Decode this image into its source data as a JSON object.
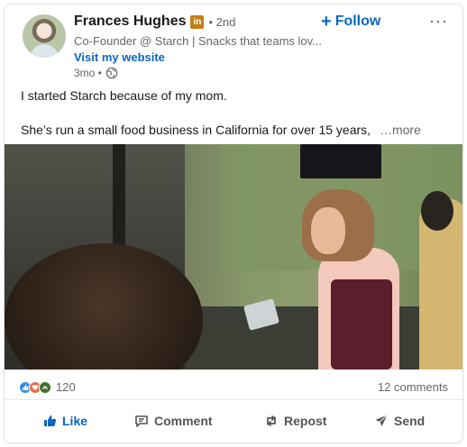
{
  "author": {
    "name": "Frances Hughes",
    "badge": "in",
    "degree": "• 2nd",
    "headline": "Co-Founder @ Starch | Snacks that teams lov...",
    "website": "Visit my website",
    "time": "3mo •",
    "visibility_icon": "globe-icon"
  },
  "follow": {
    "plus": "+",
    "label": "Follow"
  },
  "menu": {
    "label": "···"
  },
  "post": {
    "line1": "I started Starch because of my mom.",
    "line2": "She’s run a small food business in California for over 15 years,",
    "see_more": "…more"
  },
  "media": {
    "kind": "image",
    "description_icon": "cafe-photo"
  },
  "stats": {
    "reactions_count": "120",
    "comments": "12 comments",
    "reaction_types": [
      "like-icon",
      "love-icon",
      "support-icon"
    ]
  },
  "actions": {
    "like": "Like",
    "comment": "Comment",
    "repost": "Repost",
    "send": "Send"
  },
  "colors": {
    "accent": "#0a66c2",
    "text_secondary": "#666666",
    "premium_badge": "#c37d16"
  }
}
